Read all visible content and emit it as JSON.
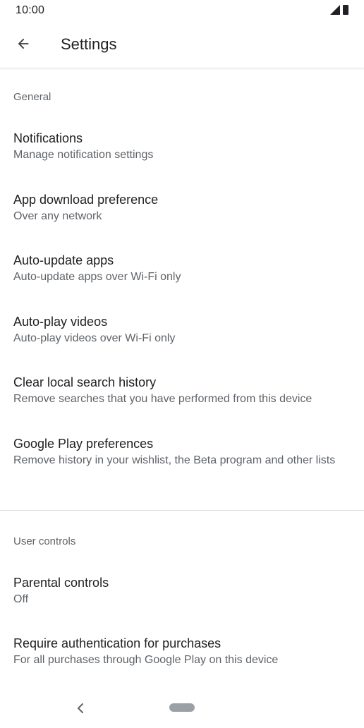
{
  "status_bar": {
    "time": "10:00",
    "icons": [
      "signal-icon",
      "battery-icon"
    ]
  },
  "app_bar": {
    "back_icon": "arrow-left-icon",
    "title": "Settings"
  },
  "sections": [
    {
      "header": "General",
      "items": [
        {
          "title": "Notifications",
          "subtitle": "Manage notification settings"
        },
        {
          "title": "App download preference",
          "subtitle": "Over any network"
        },
        {
          "title": "Auto-update apps",
          "subtitle": "Auto-update apps over Wi-Fi only"
        },
        {
          "title": "Auto-play videos",
          "subtitle": "Auto-play videos over Wi-Fi only"
        },
        {
          "title": "Clear local search history",
          "subtitle": "Remove searches that you have performed from this device"
        },
        {
          "title": "Google Play preferences",
          "subtitle": "Remove history in your wishlist, the Beta program and other lists"
        }
      ]
    },
    {
      "header": "User controls",
      "items": [
        {
          "title": "Parental controls",
          "subtitle": "Off"
        },
        {
          "title": "Require authentication for purchases",
          "subtitle": "For all purchases through Google Play on this device"
        }
      ]
    }
  ],
  "nav_bar": {
    "back_icon": "chevron-left-icon",
    "home_icon": "home-pill-icon"
  },
  "colors": {
    "primary_text": "#202124",
    "secondary_text": "#5f6368",
    "divider": "#dadce0",
    "background": "#ffffff"
  }
}
